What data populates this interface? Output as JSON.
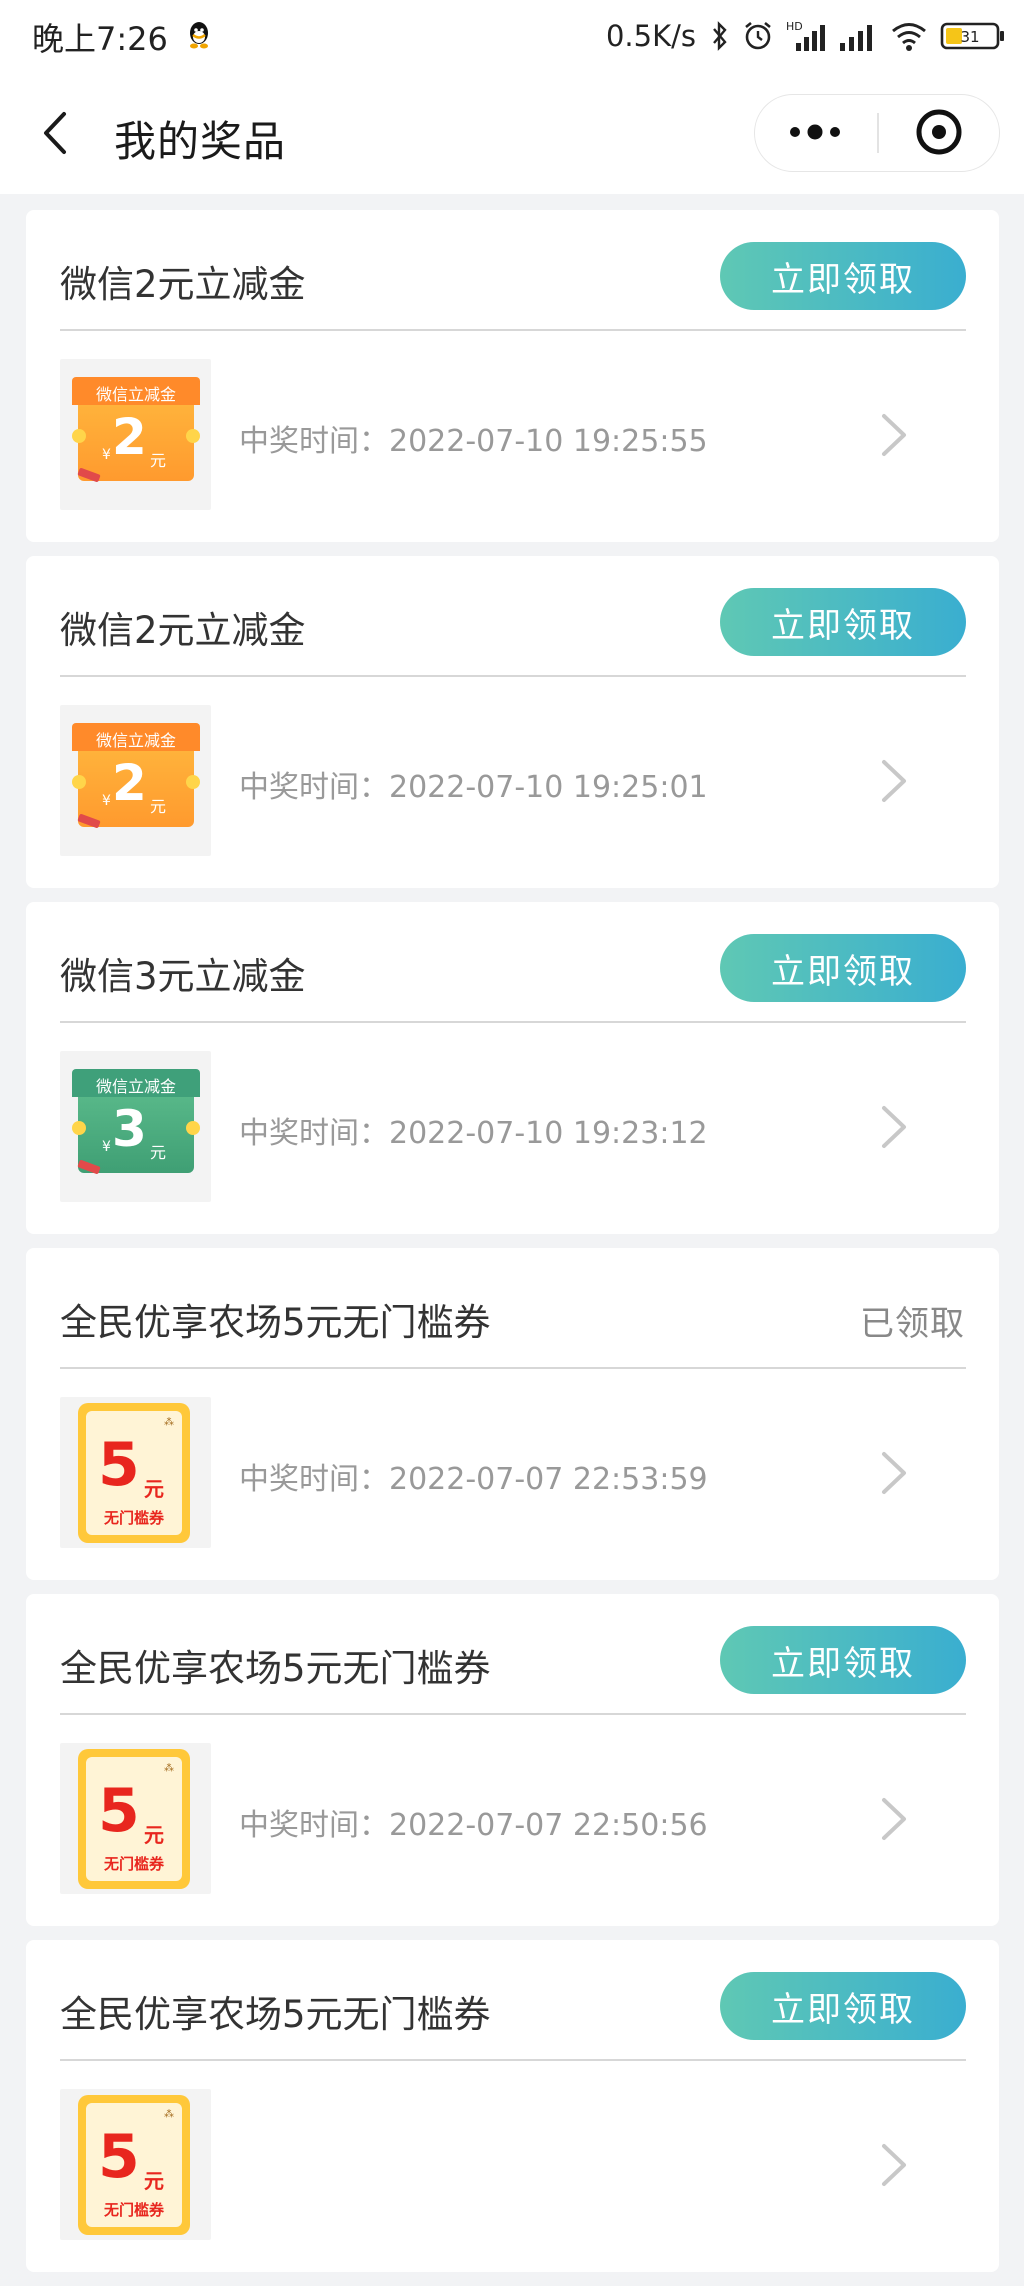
{
  "status_bar": {
    "time": "晚上7:26",
    "net_speed": "0.5K/s",
    "battery": "31",
    "icons": [
      "qq-icon",
      "bluetooth-icon",
      "alarm-icon",
      "hd-signal-icon",
      "signal-icon",
      "wifi-icon",
      "battery-icon"
    ]
  },
  "nav": {
    "title": "我的奖品",
    "icons": [
      "back-icon",
      "more-icon",
      "mini-program-close-icon"
    ]
  },
  "prizes": [
    {
      "name": "微信2元立减金",
      "action": "立即领取",
      "claimed": false,
      "time": "中奖时间：2022-07-10 19:25:55",
      "voucher": {
        "style": "orange",
        "label": "微信立减金",
        "amount": "2",
        "currency": "¥",
        "unit": "元"
      }
    },
    {
      "name": "微信2元立减金",
      "action": "立即领取",
      "claimed": false,
      "time": "中奖时间：2022-07-10 19:25:01",
      "voucher": {
        "style": "orange",
        "label": "微信立减金",
        "amount": "2",
        "currency": "¥",
        "unit": "元"
      }
    },
    {
      "name": "微信3元立减金",
      "action": "立即领取",
      "claimed": false,
      "time": "中奖时间：2022-07-10 19:23:12",
      "voucher": {
        "style": "green",
        "label": "微信立减金",
        "amount": "3",
        "currency": "¥",
        "unit": "元"
      }
    },
    {
      "name": "全民优享农场5元无门槛券",
      "action": "已领取",
      "claimed": true,
      "time": "中奖时间：2022-07-07 22:53:59",
      "voucher": {
        "style": "farm",
        "label": "无门槛券",
        "amount": "5",
        "unit": "元"
      }
    },
    {
      "name": "全民优享农场5元无门槛券",
      "action": "立即领取",
      "claimed": false,
      "time": "中奖时间：2022-07-07 22:50:56",
      "voucher": {
        "style": "farm",
        "label": "无门槛券",
        "amount": "5",
        "unit": "元"
      }
    },
    {
      "name": "全民优享农场5元无门槛券",
      "action": "立即领取",
      "claimed": false,
      "time": "",
      "voucher": {
        "style": "farm",
        "label": "无门槛券",
        "amount": "5",
        "unit": "元"
      }
    }
  ],
  "colors": {
    "page_background": "#f2f3f5",
    "card_background": "#ffffff",
    "button_gradient_start": "#5fc8b4",
    "button_gradient_end": "#3aaed0",
    "claimed_text": "#888888",
    "time_text": "#999999"
  }
}
